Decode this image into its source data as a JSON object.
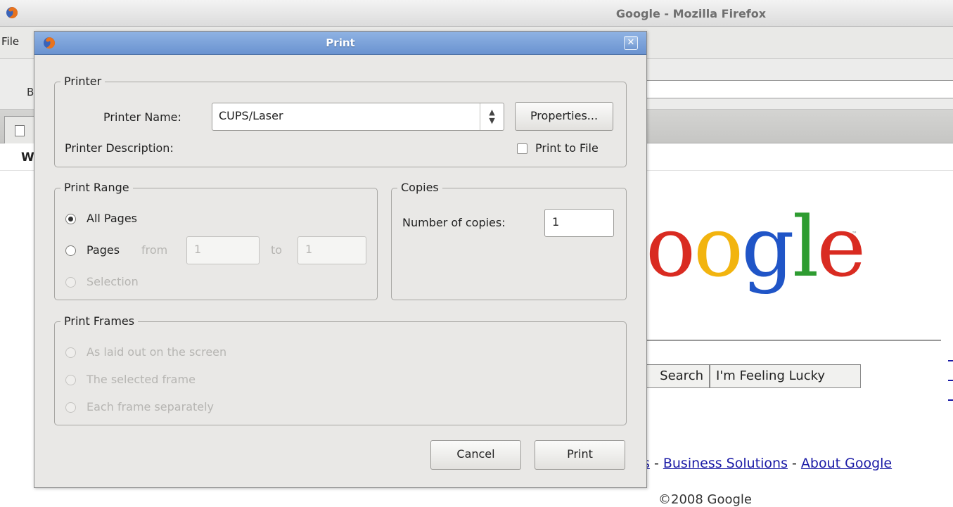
{
  "window": {
    "title": "Google - Mozilla Firefox",
    "menu_file": "File",
    "toolbar_stub": "B",
    "bookmark_stub": "W"
  },
  "google_page": {
    "logo": {
      "o1": "o",
      "o2": "o",
      "g": "g",
      "l": "l",
      "e": "e",
      "tm": "™"
    },
    "search_button": "Search",
    "lucky_button": "I'm Feeling Lucky",
    "footer_partial": "s",
    "footer_sep1": " - ",
    "footer_link_business": "Business Solutions",
    "footer_sep2": " - ",
    "footer_link_about": "About Google",
    "copyright": "©2008 Google"
  },
  "print_dialog": {
    "title": "Print",
    "close_glyph": "✕",
    "printer_group": {
      "legend": "Printer",
      "name_label": "Printer Name:",
      "name_value": "CUPS/Laser",
      "properties_button": "Properties...",
      "description_label": "Printer Description:",
      "print_to_file_label": "Print to File",
      "print_to_file_checked": false
    },
    "print_range": {
      "legend": "Print Range",
      "all_pages": "All Pages",
      "pages": "Pages",
      "from_label": "from",
      "from_value": "1",
      "to_label": "to",
      "to_value": "1",
      "selection": "Selection",
      "selected": "all_pages"
    },
    "copies": {
      "legend": "Copies",
      "number_label": "Number of copies:",
      "number_value": "1"
    },
    "print_frames": {
      "legend": "Print Frames",
      "as_laid_out": "As laid out on the screen",
      "selected_frame": "The selected frame",
      "each_separately": "Each frame separately"
    },
    "buttons": {
      "cancel": "Cancel",
      "print": "Print"
    }
  }
}
